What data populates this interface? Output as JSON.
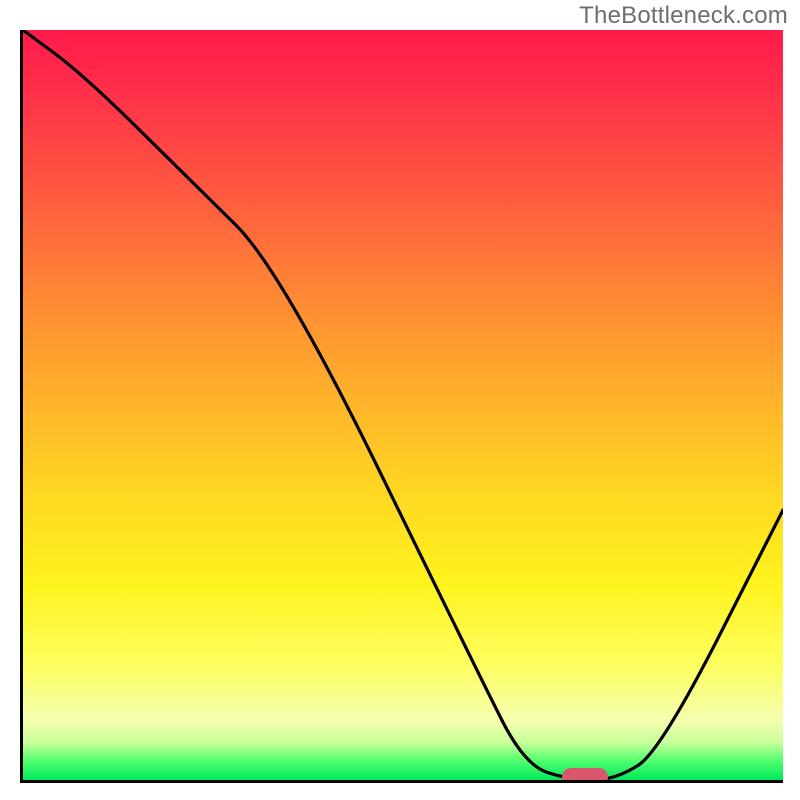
{
  "watermark": "TheBottleneck.com",
  "chart_data": {
    "type": "line",
    "title": "",
    "xlabel": "",
    "ylabel": "",
    "xlim": [
      0,
      100
    ],
    "ylim": [
      0,
      100
    ],
    "x": [
      0,
      8,
      22,
      34,
      60,
      66,
      72,
      78,
      84,
      100
    ],
    "values": [
      100,
      94,
      80,
      68,
      14,
      2,
      0,
      0,
      4,
      36
    ],
    "marker": {
      "x": 74,
      "y": 0
    },
    "background_gradient": {
      "direction": "vertical",
      "stops": [
        {
          "pos": 0,
          "color": "#ff1a4b"
        },
        {
          "pos": 0.22,
          "color": "#ff5a3f"
        },
        {
          "pos": 0.5,
          "color": "#ffb52a"
        },
        {
          "pos": 0.74,
          "color": "#fff31e"
        },
        {
          "pos": 0.92,
          "color": "#f4ffae"
        },
        {
          "pos": 1.0,
          "color": "#00e85c"
        }
      ]
    }
  }
}
